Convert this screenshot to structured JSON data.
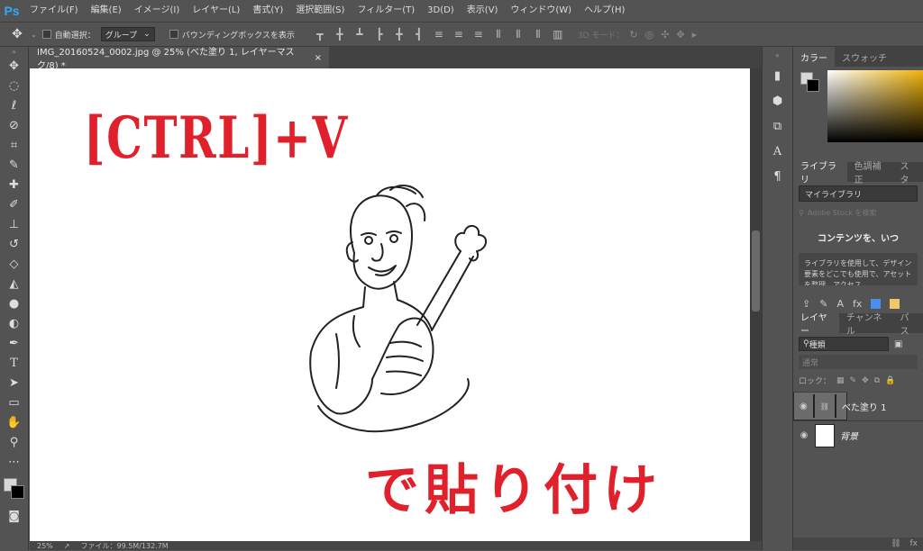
{
  "app": {
    "logo": "Ps"
  },
  "menu": [
    "ファイル(F)",
    "編集(E)",
    "イメージ(I)",
    "レイヤー(L)",
    "書式(Y)",
    "選択範囲(S)",
    "フィルター(T)",
    "3D(D)",
    "表示(V)",
    "ウィンドウ(W)",
    "ヘルプ(H)"
  ],
  "options": {
    "auto_select": "自動選択：",
    "auto_select_value": "グループ",
    "bounding_box": "バウンディングボックスを表示",
    "mode3d": "3D モード："
  },
  "document": {
    "tab_title": "IMG_20160524_0002.jpg @ 25% (べた塗り 1, レイヤーマスク/8) *",
    "close": "×"
  },
  "canvas": {
    "headline": "[CTRL]+V",
    "caption": "で貼り付け",
    "text_color": "#e0202a"
  },
  "status": {
    "zoom": "25%",
    "file": "ファイル：99.5M/132.7M"
  },
  "color_panel": {
    "tabs": [
      "カラー",
      "スウォッチ"
    ]
  },
  "library_panel": {
    "tabs": [
      "ライブラリ",
      "色調補正",
      "スタ"
    ],
    "selected": "マイライブラリ",
    "search_placeholder": "Adobe Stock を検索",
    "message": "コンテンツを、いつ",
    "body": "ライブラリを使用して、デザイン要素をどこでも使用で、アセットを整理、アクセス"
  },
  "layers_panel": {
    "tabs": [
      "レイヤー",
      "チャンネル",
      "パス"
    ],
    "filter": "種類",
    "blend": "通常",
    "lock": "ロック：",
    "layers": [
      {
        "name": "べた塗り 1",
        "thumb_color": "#4a8ff0",
        "selected": true
      },
      {
        "name": "背景",
        "thumb_color": "#ffffff",
        "selected": false
      }
    ]
  },
  "colors": {
    "swatch_blue": "#4a8ff0",
    "swatch_yellow": "#f2c66a"
  }
}
